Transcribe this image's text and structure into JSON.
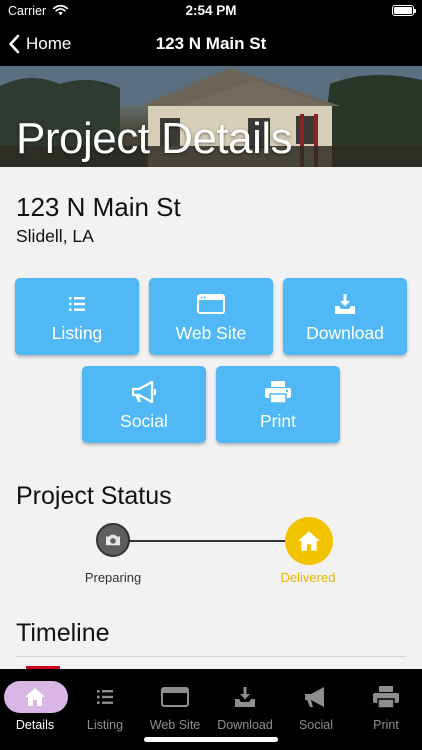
{
  "status_bar": {
    "carrier": "Carrier",
    "time": "2:54 PM",
    "battery_level": 1.0
  },
  "nav": {
    "back_label": "Home",
    "title": "123 N Main St"
  },
  "hero": {
    "title": "Project Details"
  },
  "address": {
    "street": "123 N Main St",
    "city": "Slidell, LA"
  },
  "actions": [
    {
      "label": "Listing",
      "icon": "list-icon"
    },
    {
      "label": "Web Site",
      "icon": "browser-window-icon"
    },
    {
      "label": "Download",
      "icon": "download-tray-icon"
    },
    {
      "label": "Social",
      "icon": "megaphone-icon"
    },
    {
      "label": "Print",
      "icon": "printer-icon"
    }
  ],
  "project_status": {
    "title": "Project Status",
    "stages": [
      {
        "label": "Preparing",
        "icon": "camera-icon",
        "color": "#5e5e5e"
      },
      {
        "label": "Delivered",
        "icon": "home-icon",
        "color": "#f2c300"
      }
    ],
    "current_stage": "Delivered"
  },
  "timeline": {
    "title": "Timeline"
  },
  "tabbar": {
    "active": "Details",
    "tabs": [
      {
        "label": "Details",
        "icon": "home-icon"
      },
      {
        "label": "Listing",
        "icon": "list-icon"
      },
      {
        "label": "Web Site",
        "icon": "browser-window-icon"
      },
      {
        "label": "Download",
        "icon": "download-tray-icon"
      },
      {
        "label": "Social",
        "icon": "megaphone-icon"
      },
      {
        "label": "Print",
        "icon": "printer-icon"
      }
    ]
  },
  "colors": {
    "accent_button": "#50b8f5",
    "delivered": "#f2c300",
    "active_tab_pill": "#d9b6e6",
    "tab_bar": "#000000"
  }
}
